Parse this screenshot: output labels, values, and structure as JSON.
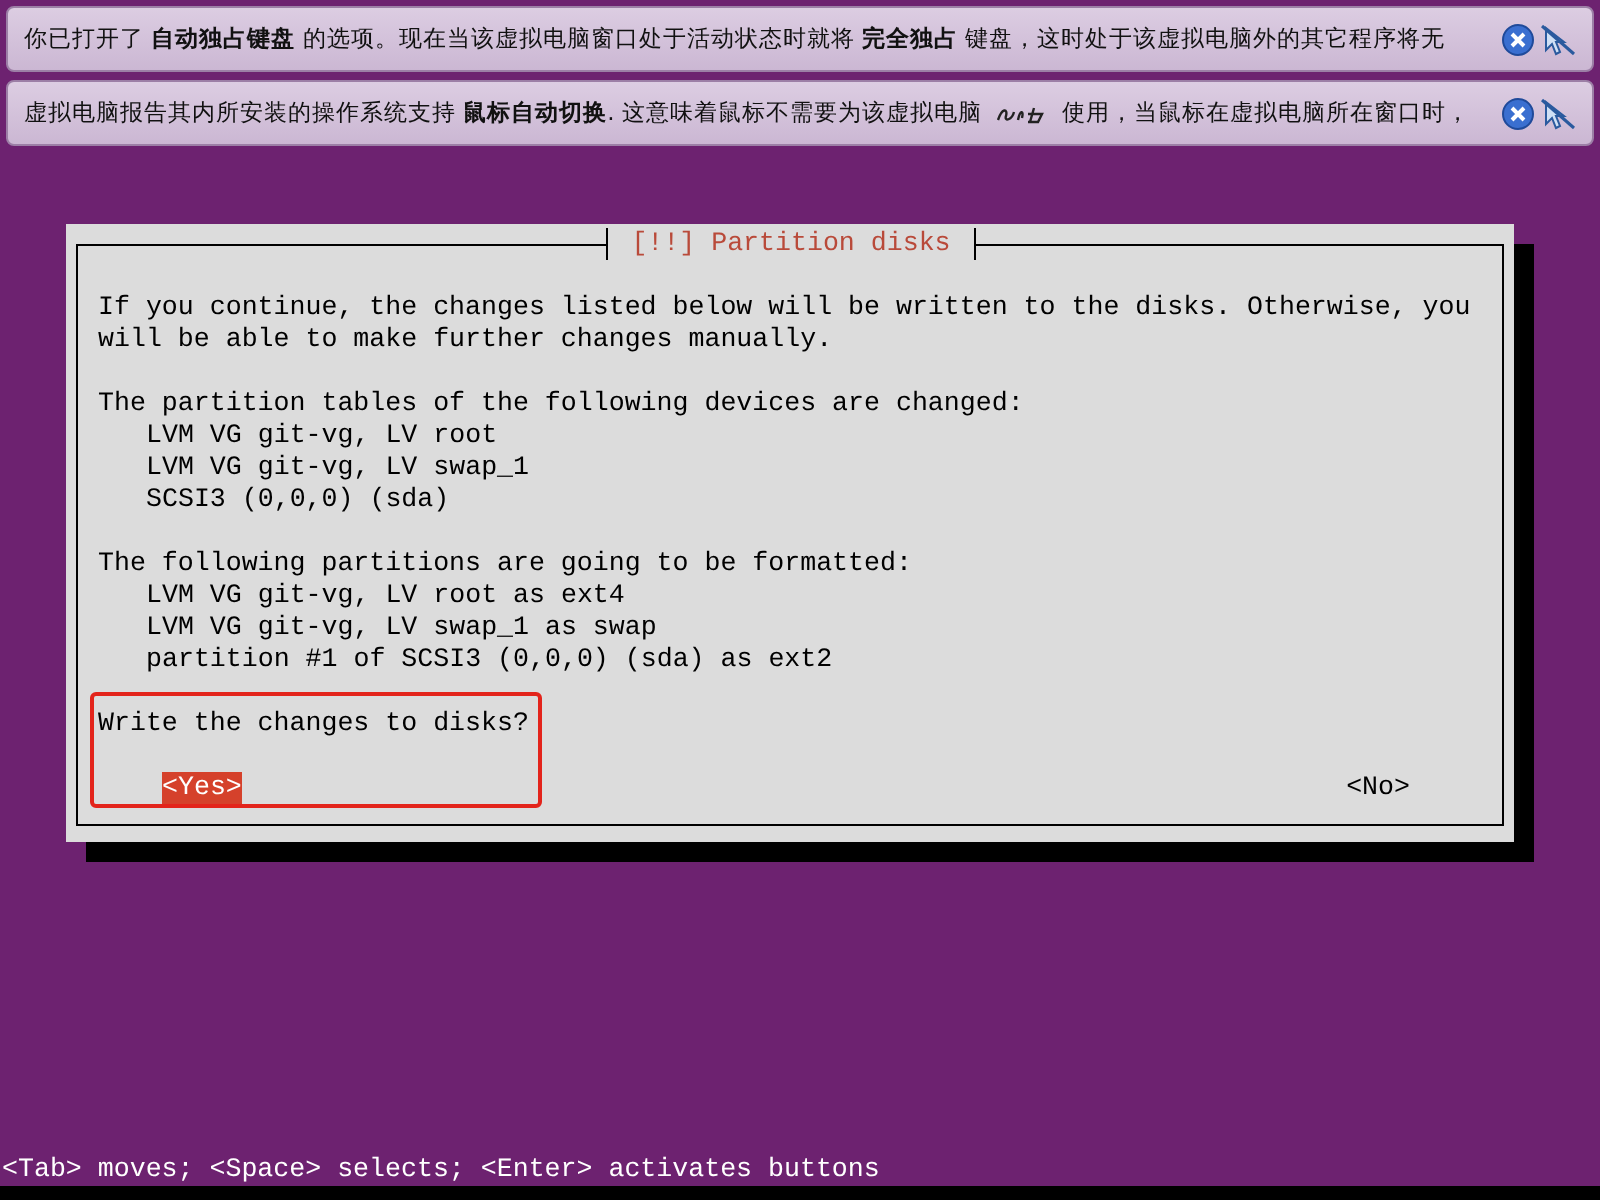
{
  "notifications": [
    {
      "segments": [
        {
          "kind": "text",
          "text": "你已打开了 **自动独占键盘** 的选项。现在当该虚拟电脑窗口处于活动状态时就将 **完全独占** 键盘，这时处于该虚拟电脑外的其它程序将无"
        }
      ]
    },
    {
      "segments": [
        {
          "kind": "text",
          "text": "虚拟电脑报告其内所安装的操作系统支持 **鼠标自动切换**. 这意味着鼠标不需要为该虚拟电脑"
        },
        {
          "kind": "icon"
        },
        {
          "kind": "text",
          "text": "使用，当鼠标在虚拟电脑所在窗口时，"
        }
      ]
    }
  ],
  "dialog": {
    "title": "[!!] Partition disks",
    "intro": [
      "If you continue, the changes listed below will be written to the disks. Otherwise, you",
      "will be able to make further changes manually."
    ],
    "sections": [
      {
        "heading": "The partition tables of the following devices are changed:",
        "items": [
          "LVM VG git-vg, LV root",
          "LVM VG git-vg, LV swap_1",
          "SCSI3 (0,0,0) (sda)"
        ]
      },
      {
        "heading": "The following partitions are going to be formatted:",
        "items": [
          "LVM VG git-vg, LV root as ext4",
          "LVM VG git-vg, LV swap_1 as swap",
          "partition #1 of SCSI3 (0,0,0) (sda) as ext2"
        ]
      }
    ],
    "question": "Write the changes to disks?",
    "buttons": [
      {
        "label": "<Yes>",
        "selected": true
      },
      {
        "label": "<No>",
        "selected": false
      }
    ]
  },
  "status_bar": "<Tab> moves; <Space> selects; <Enter> activates buttons"
}
